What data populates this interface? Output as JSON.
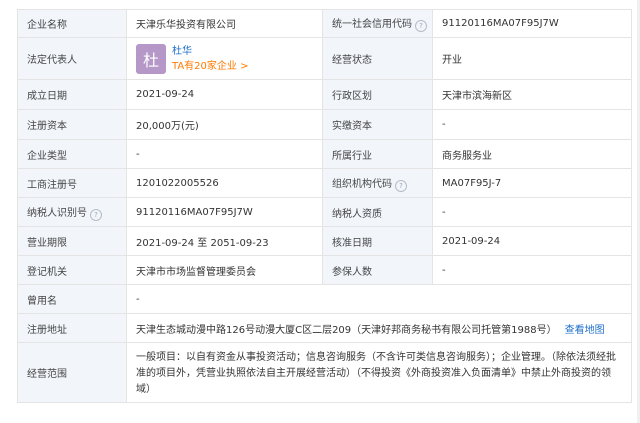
{
  "rows": [
    {
      "l1": "企业名称",
      "v1": "天津乐华投资有限公司",
      "l2": "统一社会信用代码",
      "v2": "91120116MA07F95J7W"
    },
    {
      "l1": "法定代表人",
      "l2": "经营状态",
      "v2": "开业"
    },
    {
      "l1": "成立日期",
      "v1": "2021-09-24",
      "l2": "行政区划",
      "v2": "天津市滨海新区"
    },
    {
      "l1": "注册资本",
      "v1": "20,000万(元)",
      "l2": "实缴资本",
      "v2": "-"
    },
    {
      "l1": "企业类型",
      "v1": "-",
      "l2": "所属行业",
      "v2": "商务服务业"
    },
    {
      "l1": "工商注册号",
      "v1": "1201022005526",
      "l2": "组织机构代码",
      "v2": "MA07F95J-7"
    },
    {
      "l1": "纳税人识别号",
      "v1": "91120116MA07F95J7W",
      "l2": "纳税人资质",
      "v2": "-"
    },
    {
      "l1": "营业期限",
      "v1": "2021-09-24 至 2051-09-23",
      "l2": "核准日期",
      "v2": "2021-09-24"
    },
    {
      "l1": "登记机关",
      "v1": "天津市市场监督管理委员会",
      "l2": "参保人数",
      "v2": "-"
    }
  ],
  "legal_rep": {
    "avatar_char": "杜",
    "name": "杜华",
    "company_count": "TA有20家企业 >"
  },
  "former_name": {
    "label": "曾用名",
    "value": "-"
  },
  "address": {
    "label": "注册地址",
    "value": "天津生态城动漫中路126号动漫大厦C区二层209（天津好邦商务秘书有限公司托管第1988号）",
    "map_link": "查看地图"
  },
  "scope": {
    "label": "经营范围",
    "value": "一般项目：以自有资金从事投资活动；信息咨询服务（不含许可类信息咨询服务）；企业管理。（除依法须经批准的项目外，凭营业执照依法自主开展经营活动）（不得投资《外商投资准入负面清单》中禁止外商投资的领域）"
  },
  "help_icon_glyph": "?",
  "colors": {
    "label_bg": "#f2f6fb",
    "link": "#1f6fcc",
    "orange": "#ff7a00",
    "avatar": "#b598c8",
    "border": "#e4e4e4"
  }
}
